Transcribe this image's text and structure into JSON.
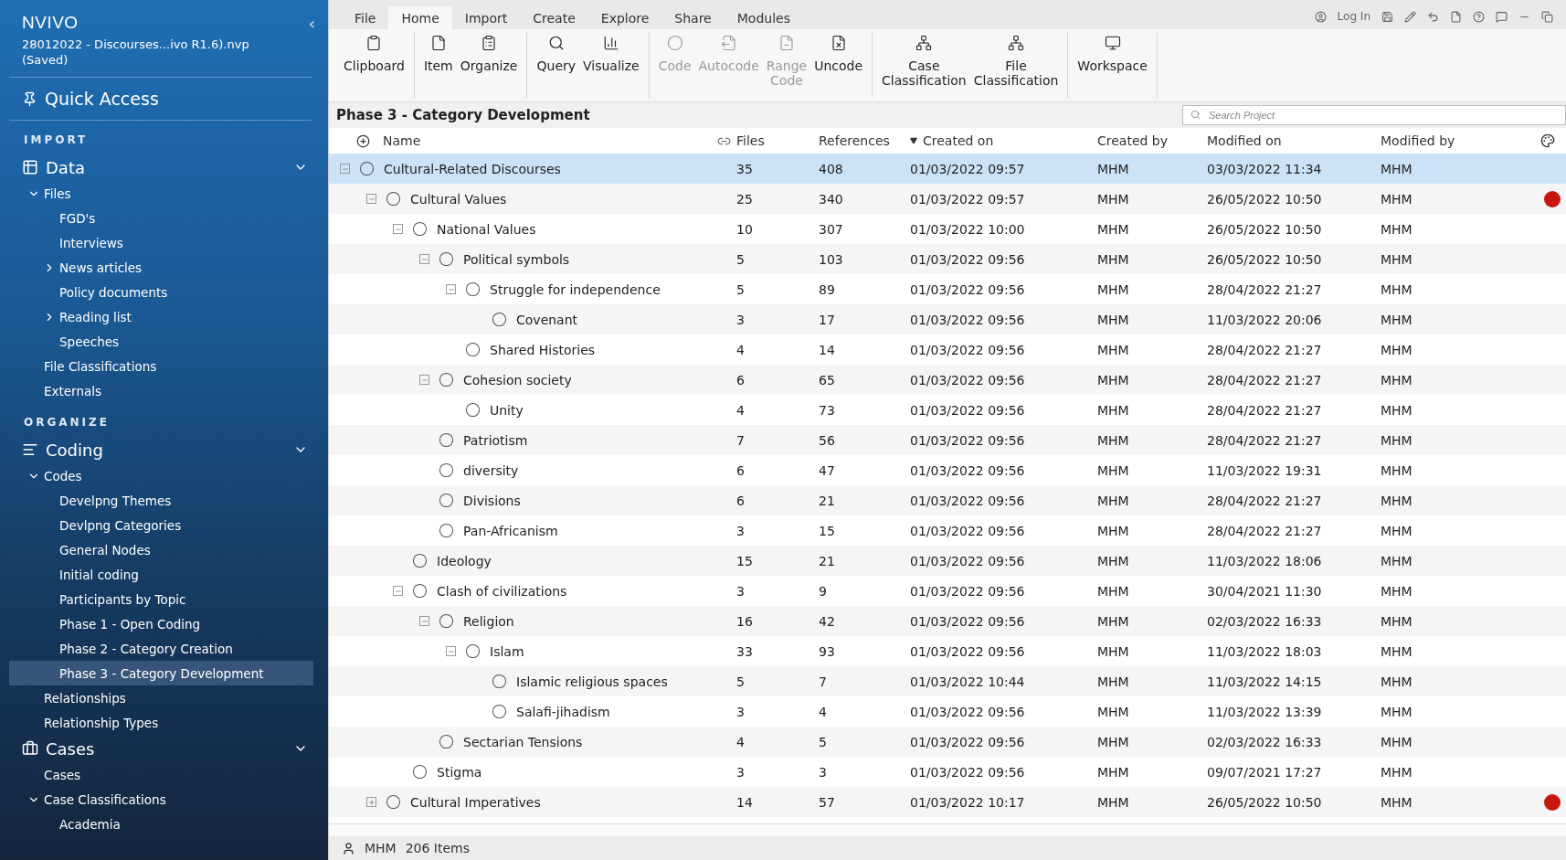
{
  "app": {
    "logo": "NVIVO",
    "project": "28012022 - Discourses...ivo R1.6).nvp",
    "save_state": "(Saved)",
    "collapse": "‹"
  },
  "quick_access": "Quick Access",
  "sidebar": [
    {
      "kind": "header",
      "label": "IMPORT"
    },
    {
      "kind": "group",
      "label": "Data",
      "expanded": true,
      "children": [
        {
          "label": "Files",
          "expanded": true,
          "children": [
            {
              "label": "FGD's"
            },
            {
              "label": "Interviews"
            },
            {
              "label": "News articles",
              "expanded": false
            },
            {
              "label": "Policy documents"
            },
            {
              "label": "Reading list",
              "expanded": false
            },
            {
              "label": "Speeches"
            }
          ]
        },
        {
          "label": "File Classifications"
        },
        {
          "label": "Externals"
        }
      ]
    },
    {
      "kind": "header",
      "label": "ORGANIZE"
    },
    {
      "kind": "group",
      "label": "Coding",
      "expanded": true,
      "children": [
        {
          "label": "Codes",
          "expanded": true,
          "children": [
            {
              "label": "Develpng Themes",
              "selected": false
            },
            {
              "label": "Devlpng Categories",
              "selected": false
            },
            {
              "label": "General Nodes",
              "selected": false
            },
            {
              "label": "Initial coding",
              "selected": false
            },
            {
              "label": "Participants by Topic",
              "selected": false
            },
            {
              "label": "Phase 1 - Open Coding",
              "selected": false
            },
            {
              "label": "Phase 2 - Category Creation",
              "selected": false
            },
            {
              "label": "Phase 3 - Category Development",
              "selected": true
            }
          ]
        },
        {
          "label": "Relationships"
        },
        {
          "label": "Relationship Types"
        }
      ]
    },
    {
      "kind": "group",
      "label": "Cases",
      "expanded": true,
      "children": [
        {
          "label": "Cases"
        },
        {
          "label": "Case Classifications",
          "expanded": true,
          "children": [
            {
              "label": "Academia"
            }
          ]
        }
      ]
    }
  ],
  "ribbon_tabs": [
    {
      "label": "File",
      "selected": false
    },
    {
      "label": "Home",
      "selected": true
    },
    {
      "label": "Import",
      "selected": false
    },
    {
      "label": "Create",
      "selected": false
    },
    {
      "label": "Explore",
      "selected": false
    },
    {
      "label": "Share",
      "selected": false
    },
    {
      "label": "Modules",
      "selected": false
    }
  ],
  "quick_toolbar": {
    "login": "Log In"
  },
  "ribbon_groups": [
    [
      {
        "label": "Clipboard",
        "disabled": false
      }
    ],
    [
      {
        "label": "Item",
        "disabled": false
      },
      {
        "label": "Organize",
        "disabled": false
      }
    ],
    [
      {
        "label": "Query",
        "disabled": false
      },
      {
        "label": "Visualize",
        "disabled": false
      }
    ],
    [
      {
        "label": "Code",
        "disabled": true
      },
      {
        "label": "Autocode",
        "disabled": true
      },
      {
        "label": "Range\nCode",
        "disabled": true
      },
      {
        "label": "Uncode",
        "disabled": false
      }
    ],
    [
      {
        "label": "Case\nClassification",
        "disabled": false
      },
      {
        "label": "File\nClassification",
        "disabled": false
      }
    ],
    [
      {
        "label": "Workspace",
        "disabled": false
      }
    ]
  ],
  "view_title": "Phase 3 - Category Development",
  "search": {
    "placeholder": "Search Project"
  },
  "table": {
    "columns": [
      "Name",
      "Files",
      "References",
      "Created on",
      "Created by",
      "Modified on",
      "Modified by"
    ],
    "rows": [
      {
        "name": "Cultural-Related Discourses",
        "files": "35",
        "references": "408",
        "created_on": "01/03/2022 09:57",
        "created_by": "MHM",
        "modified_on": "03/03/2022 11:34",
        "modified_by": "MHM",
        "selected": true,
        "expanded": true,
        "children": [
          {
            "name": "Cultural Values",
            "files": "25",
            "references": "340",
            "created_on": "01/03/2022 09:57",
            "created_by": "MHM",
            "modified_on": "26/05/2022 10:50",
            "modified_by": "MHM",
            "selected": false,
            "color": "#c8170f",
            "expanded": true,
            "children": [
              {
                "name": "National Values",
                "files": "10",
                "references": "307",
                "created_on": "01/03/2022 10:00",
                "created_by": "MHM",
                "modified_on": "26/05/2022 10:50",
                "modified_by": "MHM",
                "selected": false,
                "expanded": true,
                "children": [
                  {
                    "name": "Political symbols",
                    "files": "5",
                    "references": "103",
                    "created_on": "01/03/2022 09:56",
                    "created_by": "MHM",
                    "modified_on": "26/05/2022 10:50",
                    "modified_by": "MHM",
                    "selected": false,
                    "expanded": true,
                    "children": [
                      {
                        "name": "Struggle for independence",
                        "files": "5",
                        "references": "89",
                        "created_on": "01/03/2022 09:56",
                        "created_by": "MHM",
                        "modified_on": "28/04/2022 21:27",
                        "modified_by": "MHM",
                        "selected": false,
                        "expanded": true,
                        "children": [
                          {
                            "name": "Covenant",
                            "files": "3",
                            "references": "17",
                            "created_on": "01/03/2022 09:56",
                            "created_by": "MHM",
                            "modified_on": "11/03/2022 20:06",
                            "modified_by": "MHM",
                            "selected": false
                          }
                        ]
                      },
                      {
                        "name": "Shared Histories",
                        "files": "4",
                        "references": "14",
                        "created_on": "01/03/2022 09:56",
                        "created_by": "MHM",
                        "modified_on": "28/04/2022 21:27",
                        "modified_by": "MHM",
                        "selected": false
                      }
                    ]
                  },
                  {
                    "name": "Cohesion society",
                    "files": "6",
                    "references": "65",
                    "created_on": "01/03/2022 09:56",
                    "created_by": "MHM",
                    "modified_on": "28/04/2022 21:27",
                    "modified_by": "MHM",
                    "selected": false,
                    "expanded": true,
                    "children": [
                      {
                        "name": "Unity",
                        "files": "4",
                        "references": "73",
                        "created_on": "01/03/2022 09:56",
                        "created_by": "MHM",
                        "modified_on": "28/04/2022 21:27",
                        "modified_by": "MHM",
                        "selected": false
                      }
                    ]
                  },
                  {
                    "name": "Patriotism",
                    "files": "7",
                    "references": "56",
                    "created_on": "01/03/2022 09:56",
                    "created_by": "MHM",
                    "modified_on": "28/04/2022 21:27",
                    "modified_by": "MHM",
                    "selected": false
                  },
                  {
                    "name": "diversity",
                    "files": "6",
                    "references": "47",
                    "created_on": "01/03/2022 09:56",
                    "created_by": "MHM",
                    "modified_on": "11/03/2022 19:31",
                    "modified_by": "MHM",
                    "selected": false
                  },
                  {
                    "name": "Divisions",
                    "files": "6",
                    "references": "21",
                    "created_on": "01/03/2022 09:56",
                    "created_by": "MHM",
                    "modified_on": "28/04/2022 21:27",
                    "modified_by": "MHM",
                    "selected": false
                  },
                  {
                    "name": "Pan-Africanism",
                    "files": "3",
                    "references": "15",
                    "created_on": "01/03/2022 09:56",
                    "created_by": "MHM",
                    "modified_on": "28/04/2022 21:27",
                    "modified_by": "MHM",
                    "selected": false
                  }
                ]
              },
              {
                "name": "Ideology",
                "files": "15",
                "references": "21",
                "created_on": "01/03/2022 09:56",
                "created_by": "MHM",
                "modified_on": "11/03/2022 18:06",
                "modified_by": "MHM",
                "selected": false
              },
              {
                "name": "Clash of civilizations",
                "files": "3",
                "references": "9",
                "created_on": "01/03/2022 09:56",
                "created_by": "MHM",
                "modified_on": "30/04/2021 11:30",
                "modified_by": "MHM",
                "selected": false,
                "expanded": true,
                "children": [
                  {
                    "name": "Religion",
                    "files": "16",
                    "references": "42",
                    "created_on": "01/03/2022 09:56",
                    "created_by": "MHM",
                    "modified_on": "02/03/2022 16:33",
                    "modified_by": "MHM",
                    "selected": false,
                    "expanded": true,
                    "children": [
                      {
                        "name": "Islam",
                        "files": "33",
                        "references": "93",
                        "created_on": "01/03/2022 09:56",
                        "created_by": "MHM",
                        "modified_on": "11/03/2022 18:03",
                        "modified_by": "MHM",
                        "selected": false,
                        "expanded": true,
                        "children": [
                          {
                            "name": "Islamic religious spaces",
                            "files": "5",
                            "references": "7",
                            "created_on": "01/03/2022 10:44",
                            "created_by": "MHM",
                            "modified_on": "11/03/2022 14:15",
                            "modified_by": "MHM",
                            "selected": false
                          },
                          {
                            "name": "Salafi-jihadism",
                            "files": "3",
                            "references": "4",
                            "created_on": "01/03/2022 09:56",
                            "created_by": "MHM",
                            "modified_on": "11/03/2022 13:39",
                            "modified_by": "MHM",
                            "selected": false
                          }
                        ]
                      }
                    ]
                  },
                  {
                    "name": "Sectarian Tensions",
                    "files": "4",
                    "references": "5",
                    "created_on": "01/03/2022 09:56",
                    "created_by": "MHM",
                    "modified_on": "02/03/2022 16:33",
                    "modified_by": "MHM",
                    "selected": false
                  }
                ]
              },
              {
                "name": "Stigma",
                "files": "3",
                "references": "3",
                "created_on": "01/03/2022 09:56",
                "created_by": "MHM",
                "modified_on": "09/07/2021 17:27",
                "modified_by": "MHM",
                "selected": false
              }
            ]
          },
          {
            "name": "Cultural Imperatives",
            "files": "14",
            "references": "57",
            "created_on": "01/03/2022 10:17",
            "created_by": "MHM",
            "modified_on": "26/05/2022 10:50",
            "modified_by": "MHM",
            "selected": false,
            "color": "#c8170f",
            "expanded": false
          }
        ]
      }
    ]
  },
  "status_bar": {
    "user": "MHM",
    "items": "206 Items"
  }
}
